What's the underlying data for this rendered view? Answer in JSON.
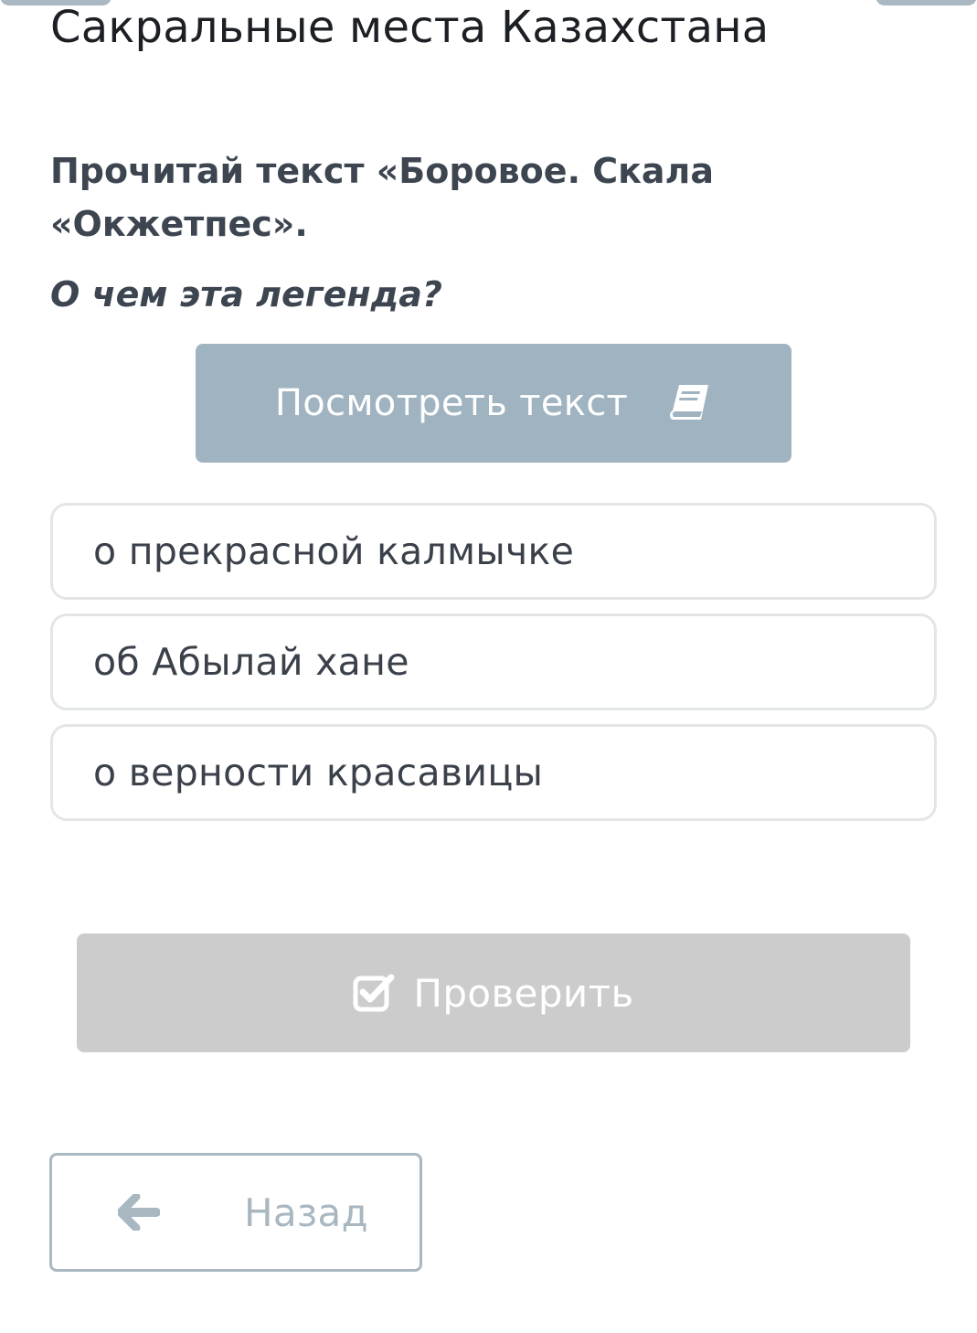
{
  "lesson": {
    "title": "Сакральные места Казахстана"
  },
  "task": {
    "instruction": "Прочитай текст «Боровое. Скала «Окжетпес».",
    "question": "О чем эта легенда?"
  },
  "view_text_button": {
    "label": "Посмотреть текст",
    "icon": "book-icon"
  },
  "answers": [
    {
      "label": "о прекрасной калмычке"
    },
    {
      "label": "об Абылай хане"
    },
    {
      "label": "о верности красавицы"
    }
  ],
  "check_button": {
    "label": "Проверить",
    "icon": "checkbox-check-icon"
  },
  "back_button": {
    "label": "Назад",
    "icon": "arrow-left-icon"
  },
  "colors": {
    "accent_button": "#9fb3c0",
    "disabled_button": "#cccccc",
    "back_border": "#aab8c2",
    "heading_text": "#3d4550"
  }
}
